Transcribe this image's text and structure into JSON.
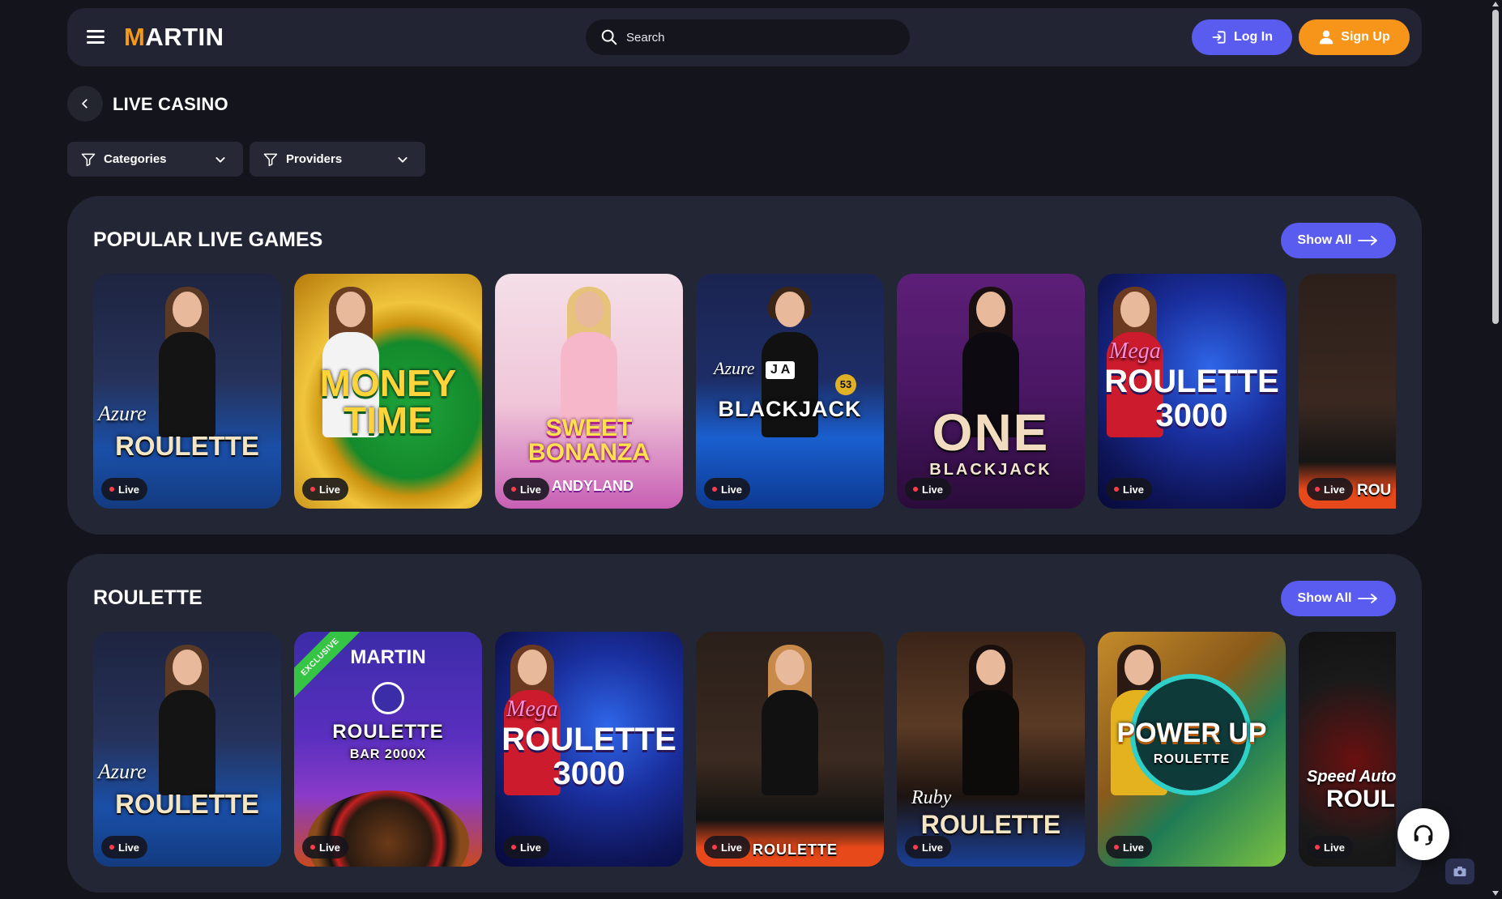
{
  "header": {
    "logo_text": "MARTIN",
    "search_placeholder": "Search",
    "login_label": "Log In",
    "signup_label": "Sign Up"
  },
  "page": {
    "title": "LIVE CASINO"
  },
  "filters": {
    "categories_label": "Categories",
    "providers_label": "Providers"
  },
  "sections": [
    {
      "title": "POPULAR LIVE GAMES",
      "show_all_label": "Show All",
      "cards": [
        {
          "name": "Azure Roulette",
          "sub": "Azure",
          "title": "ROULETTE",
          "live": "Live"
        },
        {
          "name": "Money Time",
          "sub": "",
          "title": "MONEY TIME",
          "live": "Live"
        },
        {
          "name": "Sweet Bonanza Candyland",
          "sub": "",
          "title": "SWEET BONANZA",
          "live": "Live"
        },
        {
          "name": "Azure Speed Blackjack",
          "sub": "Azure",
          "title": "BLACKJACK",
          "live": "Live"
        },
        {
          "name": "One Blackjack",
          "sub": "",
          "title": "ONE",
          "live": "Live"
        },
        {
          "name": "Mega Roulette 3000",
          "sub": "Mega",
          "title": "ROULETTE 3000",
          "live": "Live"
        },
        {
          "name": "Roulette",
          "sub": "",
          "title": "ROU",
          "live": "Live"
        }
      ]
    },
    {
      "title": "ROULETTE",
      "show_all_label": "Show All",
      "cards": [
        {
          "name": "Azure Roulette",
          "sub": "Azure",
          "title": "ROULETTE",
          "live": "Live"
        },
        {
          "name": "Martin Roulette Bar 2000x",
          "sub": "",
          "title": "ROULETTE",
          "live": "Live"
        },
        {
          "name": "Mega Roulette 3000",
          "sub": "Mega",
          "title": "ROULETTE 3000",
          "live": "Live"
        },
        {
          "name": "Roulette",
          "sub": "",
          "title": "ROULETTE",
          "live": "Live"
        },
        {
          "name": "Ruby Roulette",
          "sub": "Ruby",
          "title": "ROULETTE",
          "live": "Live"
        },
        {
          "name": "Power Up Roulette",
          "sub": "",
          "title": "POWER UP",
          "live": "Live"
        },
        {
          "name": "Speed Auto Roulette",
          "sub": "Speed Auto",
          "title": "ROUL",
          "live": "Live"
        }
      ]
    }
  ],
  "card_texts": {
    "exclusive": "EXCLUSIVE",
    "martin": "MARTIN",
    "bar": "BAR 2000X",
    "roulette_small": "ROULETTE",
    "candy_sub": "ANDYLAND",
    "blackjack_small": "BLACKJACK",
    "ja": "J A",
    "chip": "53"
  },
  "colors": {
    "accent": "#5a5cf0",
    "signup": "#f7951b",
    "live_dot": "#ff3b4e"
  }
}
